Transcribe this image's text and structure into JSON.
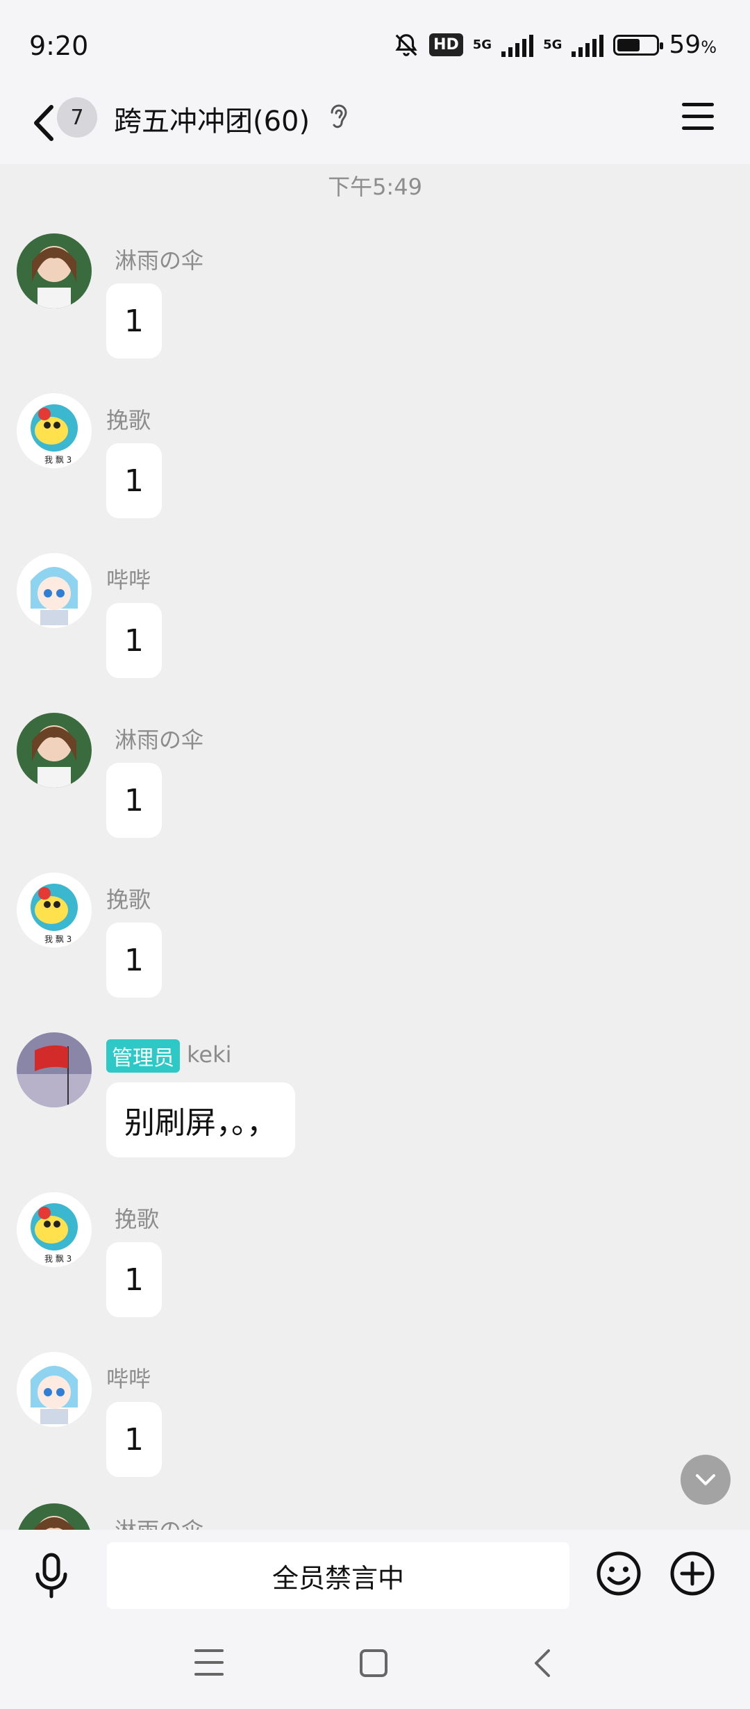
{
  "status": {
    "time": "9:20",
    "hd": "HD",
    "net1": "5G",
    "net2": "5G",
    "battery_pct": "59",
    "battery_unit": "%",
    "battery_level": 0.59
  },
  "header": {
    "unread_count": "7",
    "title": "跨五冲冲团(60)"
  },
  "chat": {
    "timestamp": "下午5:49",
    "messages": [
      {
        "sender": "淋雨の伞",
        "text": "1"
      },
      {
        "sender": "挽歌",
        "text": "1"
      },
      {
        "sender": "哔哔",
        "text": "1"
      },
      {
        "sender": "淋雨の伞",
        "text": "1"
      },
      {
        "sender": "挽歌",
        "text": "1"
      },
      {
        "sender": "keki",
        "role": "管理员",
        "text": "别刷屏，。，"
      },
      {
        "sender": "挽歌",
        "text": "1"
      },
      {
        "sender": "哔哔",
        "text": "1"
      },
      {
        "sender": "淋雨の伞",
        "text": ""
      }
    ]
  },
  "input": {
    "placeholder": "全员禁言中"
  },
  "colors": {
    "admin_tag": "#2ec9c6",
    "background": "#efefef",
    "bubble": "#ffffff"
  }
}
